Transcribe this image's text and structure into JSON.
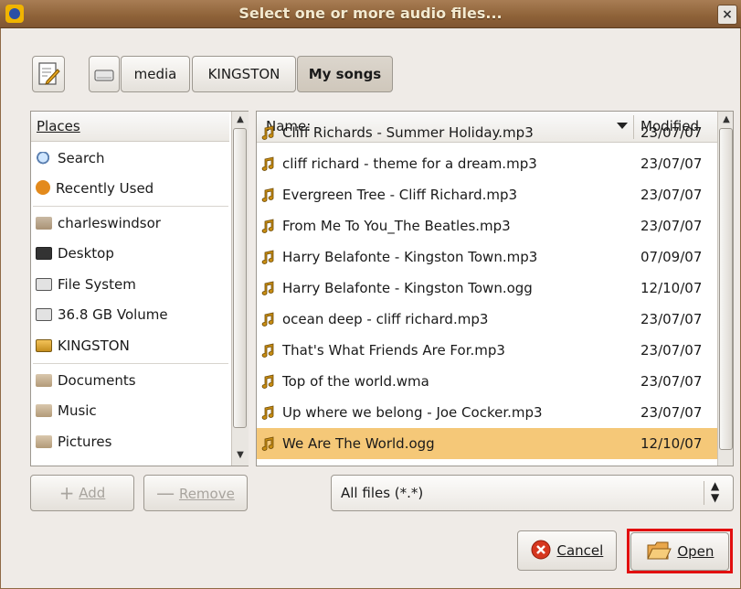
{
  "window": {
    "title": "Select one or more audio files...",
    "close_glyph": "×"
  },
  "path_bar": {
    "edit_icon": "edit-location-icon",
    "drive_icon": "drive-icon",
    "segments": [
      {
        "label": "media"
      },
      {
        "label": "KINGSTON"
      },
      {
        "label": "My songs",
        "active": true
      }
    ]
  },
  "places": {
    "header": "Places",
    "items": [
      {
        "label": "Search",
        "icon": "search-icon"
      },
      {
        "label": "Recently Used",
        "icon": "recent-icon"
      },
      {
        "label": "charleswindsor",
        "icon": "home-folder-icon"
      },
      {
        "label": "Desktop",
        "icon": "desktop-icon"
      },
      {
        "label": "File System",
        "icon": "filesystem-icon"
      },
      {
        "label": "36.8 GB Volume",
        "icon": "volume-icon"
      },
      {
        "label": "KINGSTON",
        "icon": "usb-drive-icon"
      },
      {
        "label": "Documents",
        "icon": "folder-icon"
      },
      {
        "label": "Music",
        "icon": "folder-icon"
      },
      {
        "label": "Pictures",
        "icon": "folder-icon"
      }
    ]
  },
  "files": {
    "name_header": "Name:",
    "modified_header": "Modified",
    "rows": [
      {
        "name": "Cliff Richards - Summer Holiday.mp3",
        "modified": "23/07/07"
      },
      {
        "name": "cliff richard - theme for a dream.mp3",
        "modified": "23/07/07"
      },
      {
        "name": "Evergreen Tree - Cliff Richard.mp3",
        "modified": "23/07/07"
      },
      {
        "name": "From Me To You_The Beatles.mp3",
        "modified": "23/07/07"
      },
      {
        "name": "Harry Belafonte - Kingston Town.mp3",
        "modified": "07/09/07"
      },
      {
        "name": "Harry Belafonte - Kingston Town.ogg",
        "modified": "12/10/07"
      },
      {
        "name": "ocean deep - cliff richard.mp3",
        "modified": "23/07/07"
      },
      {
        "name": "That's What Friends Are For.mp3",
        "modified": "23/07/07"
      },
      {
        "name": "Top of the world.wma",
        "modified": "23/07/07"
      },
      {
        "name": "Up where we belong  - Joe Cocker.mp3",
        "modified": "23/07/07"
      },
      {
        "name": "We Are The World.ogg",
        "modified": "12/10/07",
        "selected": true
      }
    ]
  },
  "buttons": {
    "add": "Add",
    "remove": "Remove",
    "cancel": "Cancel",
    "open": "Open"
  },
  "filter": {
    "selected": "All files (*.*)"
  },
  "colors": {
    "titlebar": "#8e6238",
    "selection": "#f5c878",
    "highlight_border": "#e20f0f"
  }
}
